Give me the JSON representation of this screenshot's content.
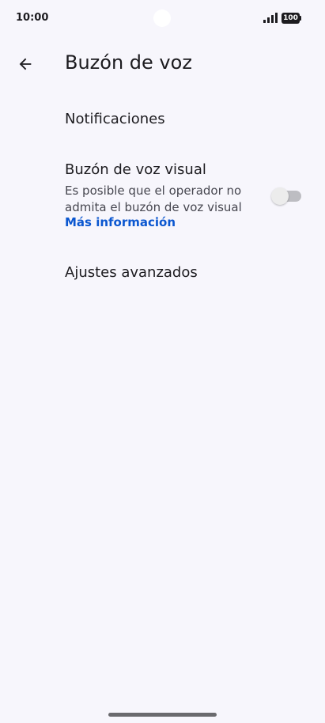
{
  "status_bar": {
    "time": "10:00",
    "battery": "100",
    "icons": [
      "signal-icon",
      "battery-icon"
    ]
  },
  "header": {
    "title": "Buzón de voz",
    "back_icon": "arrow-back-icon"
  },
  "preferences": {
    "notifications": {
      "label": "Notificaciones"
    },
    "visual_voicemail": {
      "label": "Buzón de voz visual",
      "summary": "Es posible que el operador no admita el buzón de voz visual",
      "link": "Más información",
      "toggle_on": false
    },
    "advanced": {
      "label": "Ajustes avanzados"
    }
  },
  "colors": {
    "background": "#f7f6fc",
    "link": "#0b57d0",
    "text": "#1c1b1f"
  }
}
